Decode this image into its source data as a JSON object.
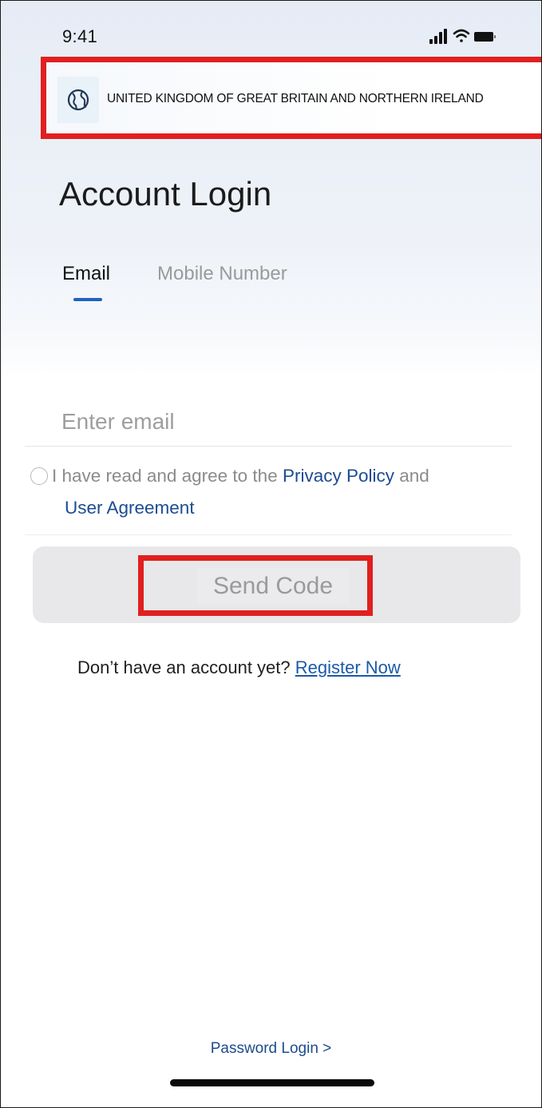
{
  "status_bar": {
    "time": "9:41",
    "icons": [
      "signal-icon",
      "wifi-icon",
      "battery-icon"
    ]
  },
  "region": {
    "icon": "globe-icon",
    "name": "UNITED KINGDOM OF GREAT BRITAIN AND NORTHERN IRELAND"
  },
  "login": {
    "title": "Account Login",
    "tabs": [
      {
        "label": "Email",
        "active": true
      },
      {
        "label": "Mobile Number",
        "active": false
      }
    ],
    "email_placeholder": "Enter email",
    "agreement": {
      "prefix": "I have read and agree to the ",
      "privacy_link": "Privacy Policy",
      "middle": " and",
      "user_agreement_link": "User Agreement"
    },
    "send_code_label": "Send Code",
    "register_prompt": "Don’t have an account yet? ",
    "register_link": "Register Now",
    "password_login": "Password Login >"
  },
  "colors": {
    "accent": "#1d63c4",
    "link": "#1c4c92",
    "highlight": "#e11f1f",
    "button_disabled": "#e8e8ea"
  }
}
